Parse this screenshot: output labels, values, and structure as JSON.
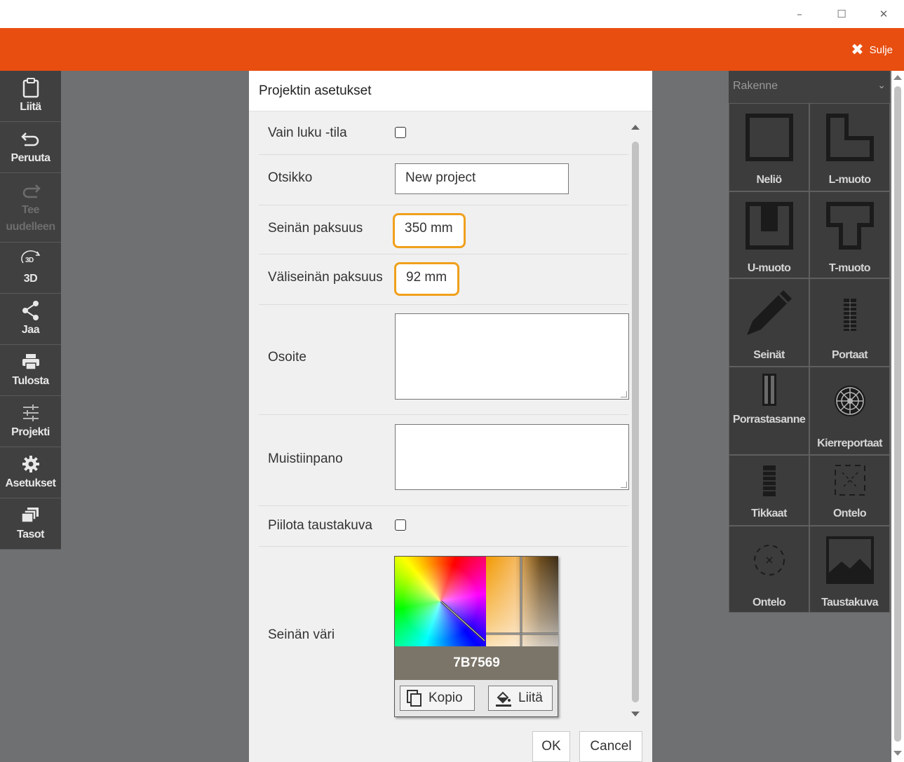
{
  "window": {
    "minimize": "–",
    "maximize": "☐",
    "close": "✕"
  },
  "header": {
    "close_label": "Sulje",
    "accent_color": "#e84e10"
  },
  "toolbar": [
    {
      "label": "Liitä",
      "icon": "clipboard-icon"
    },
    {
      "label": "Peruuta",
      "icon": "undo-icon"
    },
    {
      "label": "Tee uudelleen",
      "icon": "redo-icon",
      "disabled": true
    },
    {
      "label": "3D",
      "icon": "3d-rotate-icon"
    },
    {
      "label": "Jaa",
      "icon": "share-icon"
    },
    {
      "label": "Tulosta",
      "icon": "print-icon"
    },
    {
      "label": "Projekti",
      "icon": "sliders-icon"
    },
    {
      "label": "Asetukset",
      "icon": "gear-icon"
    },
    {
      "label": "Tasot",
      "icon": "layers-icon"
    }
  ],
  "dialog": {
    "title": "Projektin asetukset",
    "fields": {
      "readonly": {
        "label": "Vain luku -tila",
        "checked": false
      },
      "title": {
        "label": "Otsikko",
        "value": "New project"
      },
      "wall_thickness": {
        "label": "Seinän paksuus",
        "value": "350 mm"
      },
      "partition_thickness": {
        "label": "Väliseinän paksuus",
        "value": "92 mm"
      },
      "address": {
        "label": "Osoite",
        "value": ""
      },
      "notes": {
        "label": "Muistiinpano",
        "value": ""
      },
      "hide_background": {
        "label": "Piilota taustakuva",
        "checked": false
      },
      "wall_color": {
        "label": "Seinän väri",
        "hex": "7B7569",
        "color": "#7b7569",
        "copy_label": "Kopio",
        "paste_label": "Liitä"
      }
    },
    "ok_label": "OK",
    "cancel_label": "Cancel"
  },
  "right_panel": {
    "select_value": "Rakenne",
    "items": [
      {
        "label": "Neliö",
        "icon": "square-room-icon"
      },
      {
        "label": "L-muoto",
        "icon": "l-shape-icon"
      },
      {
        "label": "U-muoto",
        "icon": "u-shape-icon"
      },
      {
        "label": "T-muoto",
        "icon": "t-shape-icon"
      },
      {
        "label": "Seinät",
        "icon": "pencil-icon"
      },
      {
        "label": "Portaat",
        "icon": "stairs-icon"
      },
      {
        "label": "Porrastasanne",
        "icon": "landing-icon"
      },
      {
        "label": "Kierreportaat",
        "icon": "spiral-stairs-icon"
      },
      {
        "label": "Tikkaat",
        "icon": "ladder-icon"
      },
      {
        "label": "Ontelo",
        "icon": "void-square-icon"
      },
      {
        "label": "Ontelo",
        "icon": "void-circle-icon"
      },
      {
        "label": "Taustakuva",
        "icon": "background-image-icon"
      }
    ]
  }
}
